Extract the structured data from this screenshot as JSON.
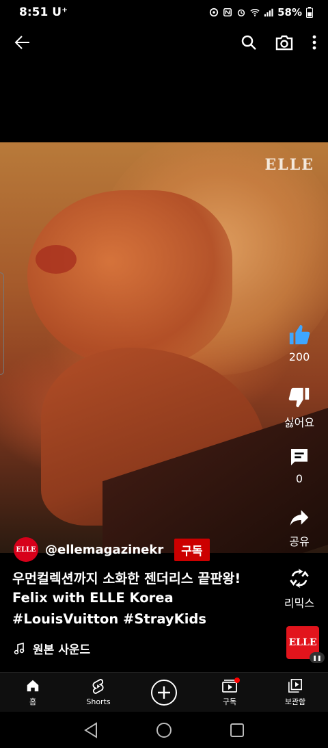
{
  "status": {
    "time": "8:51",
    "carrier": "U⁺",
    "battery": "58%"
  },
  "video": {
    "watermark": "ELLE"
  },
  "actions": {
    "like_count": "200",
    "dislike_label": "싫어요",
    "comment_count": "0",
    "share_label": "공유",
    "remix_label": "리믹스"
  },
  "channel": {
    "avatar_text": "ELLE",
    "name": "@ellemagazinekr",
    "subscribe_label": "구독"
  },
  "caption": {
    "title": "우먼컬렉션까지 소화한 젠더리스 끝판왕! Felix with ELLE Korea",
    "hashtags": "#LouisVuitton  #StrayKids"
  },
  "sound": {
    "label": "원본 사운드",
    "thumb_text": "ELLE"
  },
  "bottom_nav": {
    "home": "홈",
    "shorts": "Shorts",
    "subscriptions": "구독",
    "library": "보관함"
  }
}
